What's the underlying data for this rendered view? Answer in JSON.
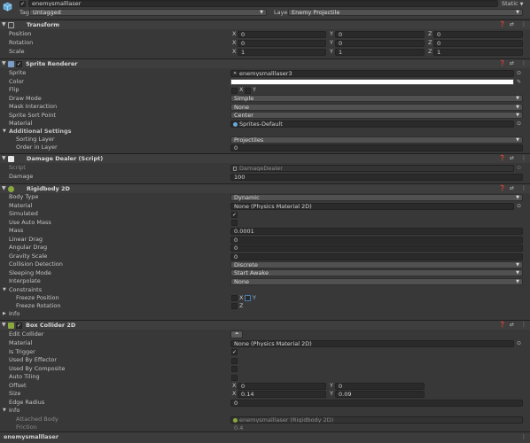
{
  "header": {
    "object_name": "enemysmalllaser",
    "static_label": "Static",
    "tag_label": "Tag",
    "tag_value": "Untagged",
    "layer_label": "Layer",
    "layer_value": "Enemy Projectile"
  },
  "transform": {
    "title": "Transform",
    "position_label": "Position",
    "rotation_label": "Rotation",
    "scale_label": "Scale",
    "axis_x": "X",
    "axis_y": "Y",
    "axis_z": "Z",
    "position": {
      "x": "0",
      "y": "0",
      "z": "0"
    },
    "rotation": {
      "x": "0",
      "y": "0",
      "z": "0"
    },
    "scale": {
      "x": "1",
      "y": "1",
      "z": "1"
    }
  },
  "sprite_renderer": {
    "title": "Sprite Renderer",
    "sprite_label": "Sprite",
    "sprite_value": "enemysmalllaser3",
    "color_label": "Color",
    "color_value": "#ffffff",
    "flip_label": "Flip",
    "flip_x": "X",
    "flip_y": "Y",
    "draw_mode_label": "Draw Mode",
    "draw_mode_value": "Simple",
    "mask_label": "Mask Interaction",
    "mask_value": "None",
    "sort_point_label": "Sprite Sort Point",
    "sort_point_value": "Center",
    "material_label": "Material",
    "material_value": "Sprites-Default",
    "additional_label": "Additional Settings",
    "sorting_layer_label": "Sorting Layer",
    "sorting_layer_value": "Projectiles",
    "order_label": "Order in Layer",
    "order_value": "0"
  },
  "damage_dealer": {
    "title": "Damage Dealer (Script)",
    "script_label": "Script",
    "script_value": "DamageDealer",
    "damage_label": "Damage",
    "damage_value": "100"
  },
  "rigidbody": {
    "title": "Rigidbody 2D",
    "body_type_label": "Body Type",
    "body_type_value": "Dynamic",
    "material_label": "Material",
    "material_value": "None (Physics Material 2D)",
    "simulated_label": "Simulated",
    "auto_mass_label": "Use Auto Mass",
    "mass_label": "Mass",
    "mass_value": "0.0001",
    "linear_drag_label": "Linear Drag",
    "linear_drag_value": "0",
    "angular_drag_label": "Angular Drag",
    "angular_drag_value": "0",
    "gravity_label": "Gravity Scale",
    "gravity_value": "0",
    "collision_label": "Collision Detection",
    "collision_value": "Discrete",
    "sleeping_label": "Sleeping Mode",
    "sleeping_value": "Start Awake",
    "interpolate_label": "Interpolate",
    "interpolate_value": "None",
    "constraints_label": "Constraints",
    "freeze_pos_label": "Freeze Position",
    "freeze_rot_label": "Freeze Rotation",
    "fx": "X",
    "fy": "Y",
    "fz": "Z",
    "info_label": "Info"
  },
  "box_collider": {
    "title": "Box Collider 2D",
    "edit_label": "Edit Collider",
    "material_label": "Material",
    "material_value": "None (Physics Material 2D)",
    "trigger_label": "Is Trigger",
    "effector_label": "Used By Effector",
    "composite_label": "Used By Composite",
    "tiling_label": "Auto Tiling",
    "offset_label": "Offset",
    "offset_x": "0",
    "offset_y": "0",
    "size_label": "Size",
    "size_x": "0.14",
    "size_y": "0.09",
    "edge_label": "Edge Radius",
    "edge_value": "0",
    "info_label": "Info",
    "attached_label": "Attached Body",
    "attached_value": "enemysmalllaser (Rigidbody 2D)",
    "friction_label": "Friction",
    "friction_value": "0.4"
  },
  "footer": {
    "object_name": "enemysmalllaser"
  }
}
